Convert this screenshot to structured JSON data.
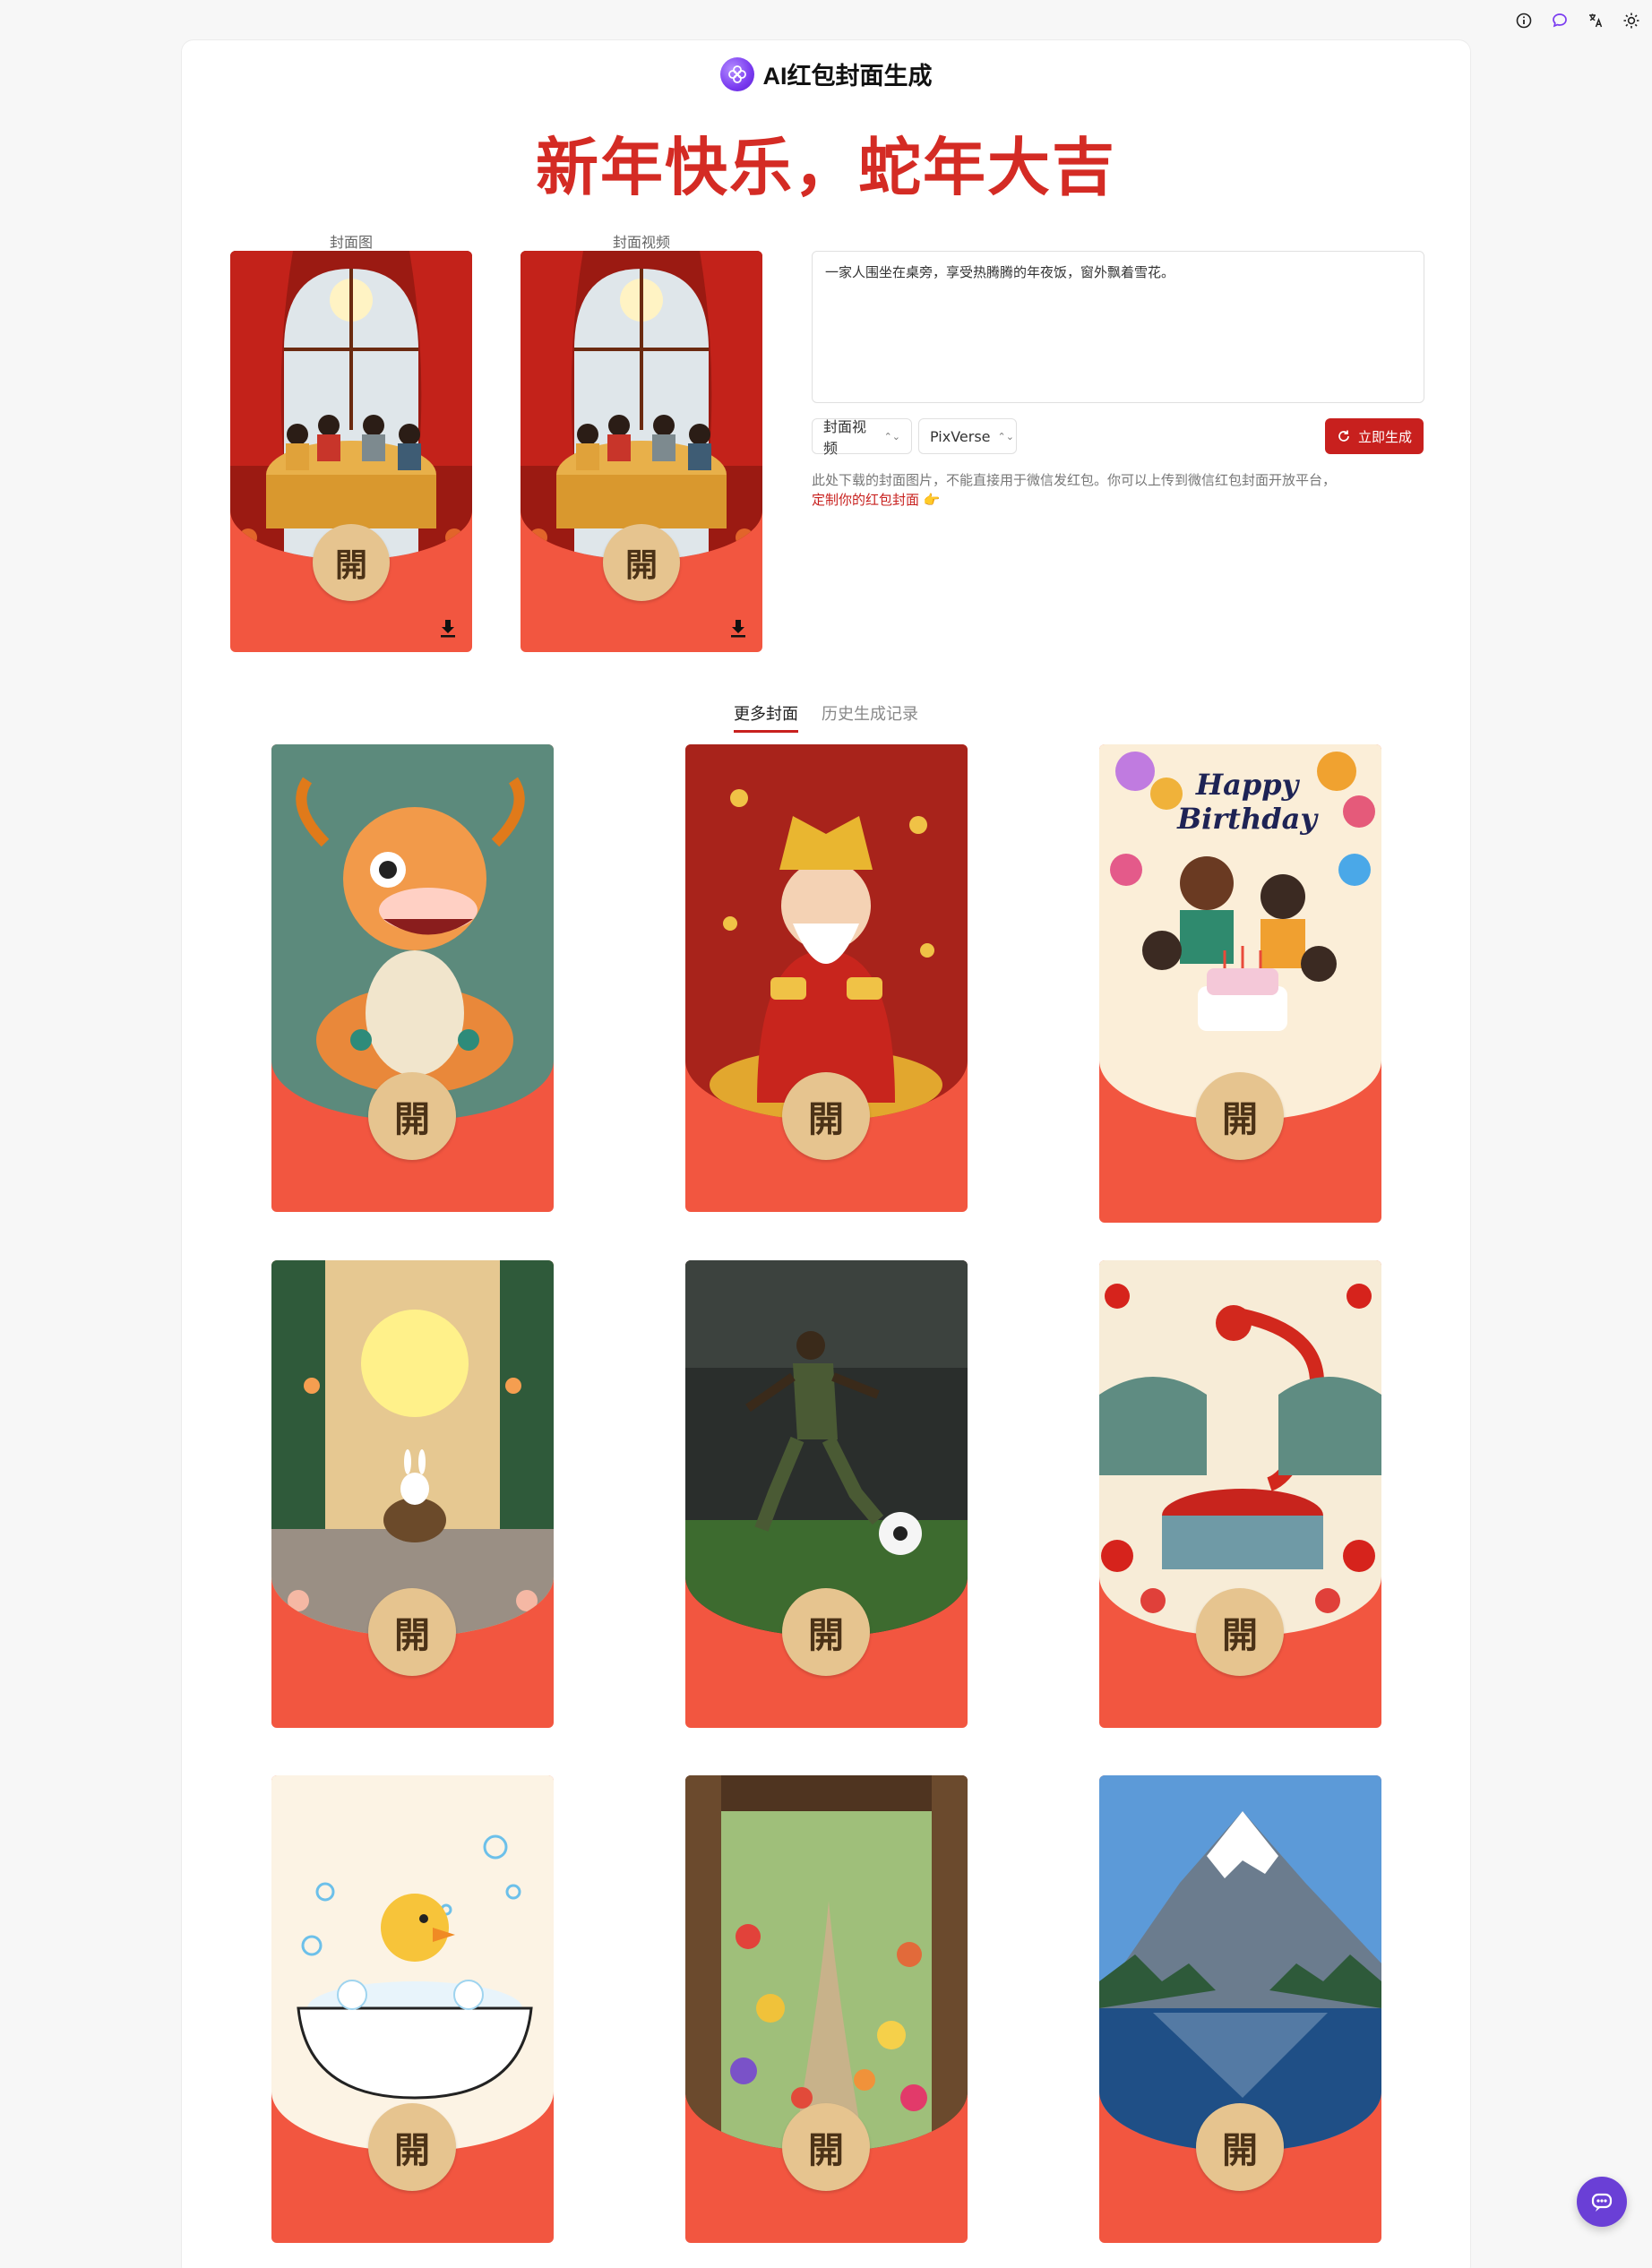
{
  "brand": {
    "title": "AI红包封面生成"
  },
  "headline": "新年快乐，蛇年大吉",
  "previews": [
    {
      "label": "封面图",
      "open_glyph": "開"
    },
    {
      "label": "封面视频",
      "open_glyph": "開"
    }
  ],
  "prompt": {
    "value": "一家人围坐在桌旁，享受热腾腾的年夜饭，窗外飘着雪花。"
  },
  "controls": {
    "type_select": "封面视频",
    "model_select": "PixVerse",
    "generate_label": "立即生成"
  },
  "note": {
    "text": "此处下载的封面图片，不能直接用于微信发红包。你可以上传到微信红包封面开放平台，",
    "link": "定制你的红包封面",
    "emoji": "👉"
  },
  "tabs": [
    {
      "label": "更多封面",
      "active": true
    },
    {
      "label": "历史生成记录",
      "active": false
    }
  ],
  "gallery": [
    {
      "theme": "dragon-cartoon",
      "open_glyph": "開"
    },
    {
      "theme": "god-of-wealth",
      "open_glyph": "開"
    },
    {
      "theme": "happy-birthday",
      "open_glyph": "開",
      "caption": "Happy Birthday"
    },
    {
      "theme": "moon-rabbit",
      "open_glyph": "開"
    },
    {
      "theme": "soccer-player",
      "open_glyph": "開"
    },
    {
      "theme": "paper-dragon-feast",
      "open_glyph": "開"
    },
    {
      "theme": "duckling-bath",
      "open_glyph": "開"
    },
    {
      "theme": "garden-door",
      "open_glyph": "開"
    },
    {
      "theme": "snow-mountain-lake",
      "open_glyph": "開"
    }
  ],
  "colors": {
    "accent": "#c8201e",
    "envelope": "#f25640",
    "open_button": "#e6c48f",
    "headline": "#d42b24",
    "fab": "#6a3fd6"
  }
}
